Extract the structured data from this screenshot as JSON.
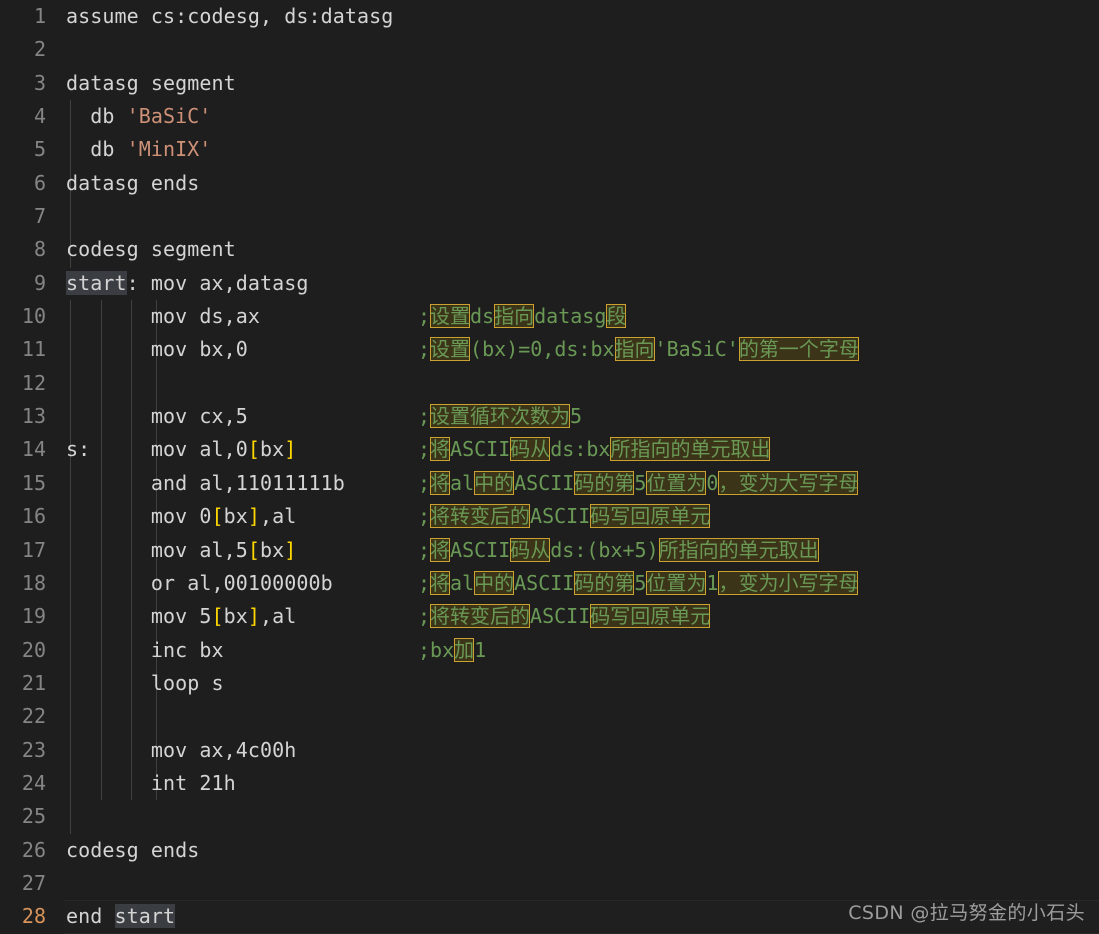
{
  "editor": {
    "language": "assembly",
    "theme": "dark-plus",
    "background": "#1e1e1e",
    "line_number_color": "#858585",
    "active_line_number_color": "#d7935a",
    "comment_color": "#6a9955",
    "string_color": "#ce9178",
    "bracket_color": "#ffd700",
    "selection_color": "#3a3d41",
    "match_highlight_bg": "#3b3418",
    "match_highlight_border": "#cba22f",
    "active_line_number": 28,
    "total_lines": 28
  },
  "watermark": {
    "text": "CSDN @拉马努金的小石头"
  },
  "lines": [
    {
      "n": "1",
      "code": "assume cs:codesg, ds:datasg",
      "comment": ""
    },
    {
      "n": "2",
      "code": "",
      "comment": ""
    },
    {
      "n": "3",
      "code": "datasg segment",
      "comment": ""
    },
    {
      "n": "4",
      "code": "  db 'BaSiC'",
      "comment": ""
    },
    {
      "n": "5",
      "code": "  db 'MinIX'",
      "comment": ""
    },
    {
      "n": "6",
      "code": "datasg ends",
      "comment": ""
    },
    {
      "n": "7",
      "code": "",
      "comment": ""
    },
    {
      "n": "8",
      "code": "codesg segment",
      "comment": ""
    },
    {
      "n": "9",
      "code": "start: mov ax,datasg",
      "comment": ""
    },
    {
      "n": "10",
      "code": "       mov ds,ax",
      "comment": ";设置ds指向datasg段"
    },
    {
      "n": "11",
      "code": "       mov bx,0",
      "comment": ";设置(bx)=0,ds:bx指向'BaSiC'的第一个字母"
    },
    {
      "n": "12",
      "code": "",
      "comment": ""
    },
    {
      "n": "13",
      "code": "       mov cx,5",
      "comment": ";设置循环次数为5"
    },
    {
      "n": "14",
      "code": "s:     mov al,0[bx]",
      "comment": ";将ASCII码从ds:bx所指向的单元取出"
    },
    {
      "n": "15",
      "code": "       and al,11011111b",
      "comment": ";将al中的ASCII码的第5位置为0，变为大写字母"
    },
    {
      "n": "16",
      "code": "       mov 0[bx],al",
      "comment": ";将转变后的ASCII码写回原单元"
    },
    {
      "n": "17",
      "code": "       mov al,5[bx]",
      "comment": ";将ASCII码从ds:(bx+5)所指向的单元取出"
    },
    {
      "n": "18",
      "code": "       or al,00100000b",
      "comment": ";将al中的ASCII码的第5位置为1，变为小写字母"
    },
    {
      "n": "19",
      "code": "       mov 5[bx],al",
      "comment": ";将转变后的ASCII码写回原单元"
    },
    {
      "n": "20",
      "code": "       inc bx",
      "comment": ";bx加1"
    },
    {
      "n": "21",
      "code": "       loop s",
      "comment": ""
    },
    {
      "n": "22",
      "code": "",
      "comment": ""
    },
    {
      "n": "23",
      "code": "       mov ax,4c00h",
      "comment": ""
    },
    {
      "n": "24",
      "code": "       int 21h",
      "comment": ""
    },
    {
      "n": "25",
      "code": "",
      "comment": ""
    },
    {
      "n": "26",
      "code": "codesg ends",
      "comment": ""
    },
    {
      "n": "27",
      "code": "",
      "comment": ""
    },
    {
      "n": "28",
      "code": "end start",
      "comment": ""
    }
  ],
  "selected_word": "start",
  "highlighted_runs": [
    "设置",
    "指向",
    "段",
    "的第一个字母",
    "设置循环次数为",
    "将",
    "码从",
    "所指向的单元取出",
    "中的",
    "码的第",
    "位置为",
    "，变为大写字母",
    "将转变后的",
    "码写回原单元",
    "，变为小写字母",
    "加"
  ]
}
